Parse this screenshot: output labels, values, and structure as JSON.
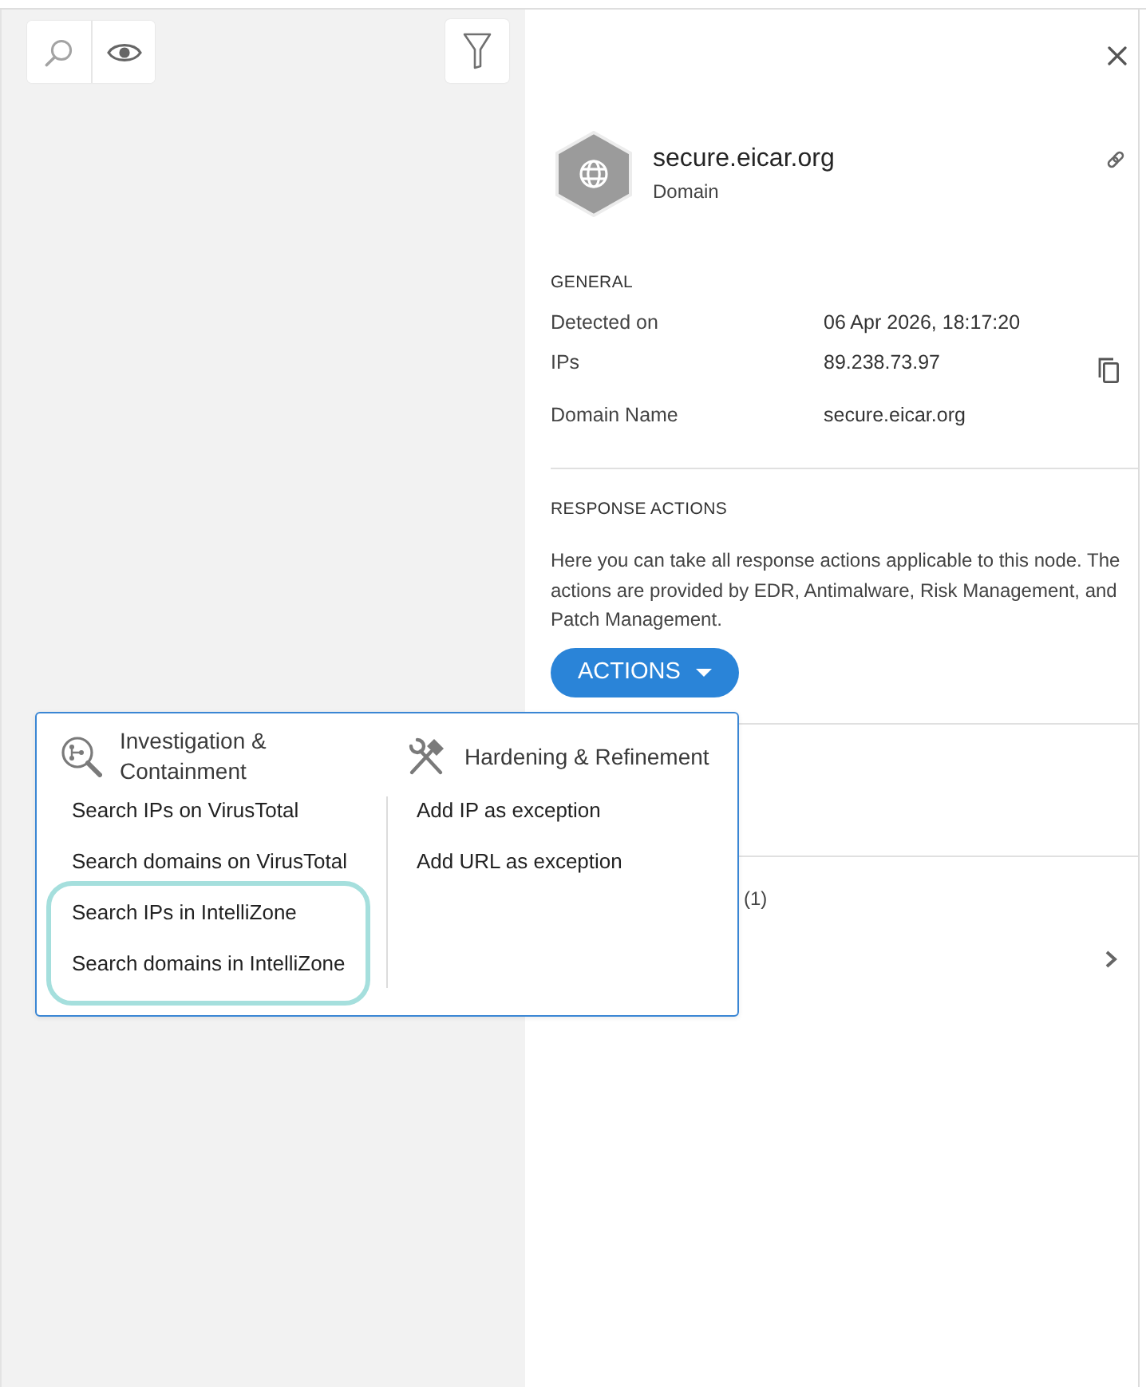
{
  "panel": {
    "title": "secure.eicar.org",
    "subtitle": "Domain",
    "general": {
      "heading": "GENERAL",
      "rows": [
        {
          "label": "Detected on",
          "value": "06 Apr 2026, 18:17:20",
          "copyable": false
        },
        {
          "label": "IPs",
          "value": "89.238.73.97",
          "copyable": true
        },
        {
          "label": "Domain Name",
          "value": "secure.eicar.org",
          "copyable": false
        }
      ]
    },
    "response_actions": {
      "heading": "RESPONSE ACTIONS",
      "description": "Here you can take all response actions applicable to this node. The actions are provided by EDR, Antimalware, Risk Management, and Patch Management.",
      "button": {
        "label": "ACTIONS",
        "expanded": true
      }
    },
    "next_section": {
      "count": "(1)"
    }
  },
  "actions_menu": {
    "groups": [
      {
        "kind": "investigation",
        "title": "Investigation & Containment",
        "items": [
          {
            "label": "Search IPs on VirusTotal",
            "highlighted": false
          },
          {
            "label": "Search domains on VirusTotal",
            "highlighted": false
          },
          {
            "label": "Search IPs in IntelliZone",
            "highlighted": true
          },
          {
            "label": "Search domains in IntelliZone",
            "highlighted": true
          }
        ]
      },
      {
        "kind": "hardening",
        "title": "Hardening & Refinement",
        "items": [
          {
            "label": "Add IP as exception",
            "highlighted": false
          },
          {
            "label": "Add URL as exception",
            "highlighted": false
          }
        ]
      }
    ]
  }
}
